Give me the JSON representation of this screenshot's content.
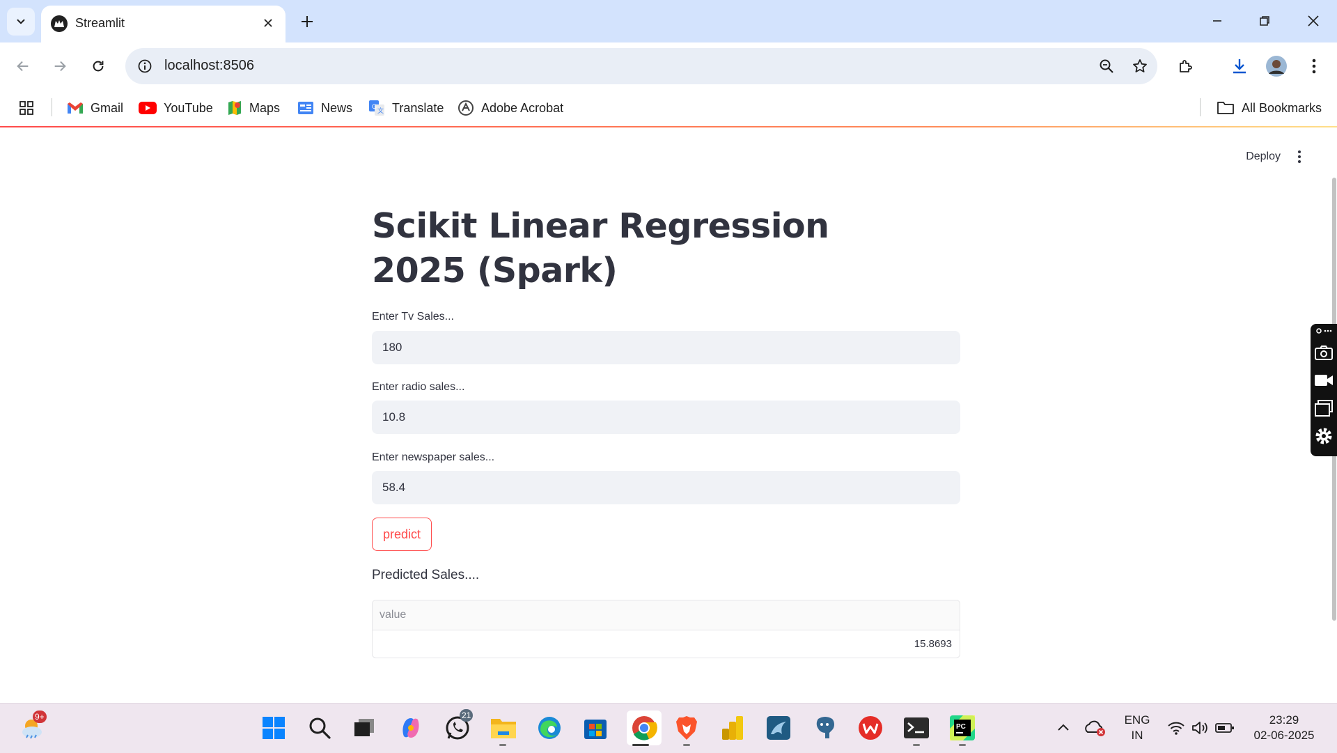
{
  "browser": {
    "tab_title": "Streamlit",
    "url": "localhost:8506",
    "bookmarks": [
      {
        "label": "Gmail",
        "icon": "gmail-icon"
      },
      {
        "label": "YouTube",
        "icon": "youtube-icon"
      },
      {
        "label": "Maps",
        "icon": "maps-icon"
      },
      {
        "label": "News",
        "icon": "news-icon"
      },
      {
        "label": "Translate",
        "icon": "translate-icon"
      },
      {
        "label": "Adobe Acrobat",
        "icon": "acrobat-icon"
      }
    ],
    "all_bookmarks": "All Bookmarks"
  },
  "app": {
    "deploy_label": "Deploy",
    "title": "Scikit Linear Regression 2025 (Spark)",
    "fields": [
      {
        "label": "Enter Tv Sales...",
        "value": "180"
      },
      {
        "label": "Enter radio sales...",
        "value": "10.8"
      },
      {
        "label": "Enter newspaper sales...",
        "value": "58.4"
      }
    ],
    "predict_label": "predict",
    "result_heading": "Predicted Sales....",
    "table": {
      "column": "value",
      "rows": [
        "15.8693"
      ]
    }
  },
  "taskbar": {
    "weather_badge": "9+",
    "whatsapp_badge": "21",
    "lang_top": "ENG",
    "lang_bottom": "IN",
    "time": "23:29",
    "date": "02-06-2025"
  },
  "colors": {
    "accent": "#ff4b4b",
    "input_bg": "#f0f2f6",
    "text": "#31333f",
    "tab_strip": "#d3e3fd"
  }
}
